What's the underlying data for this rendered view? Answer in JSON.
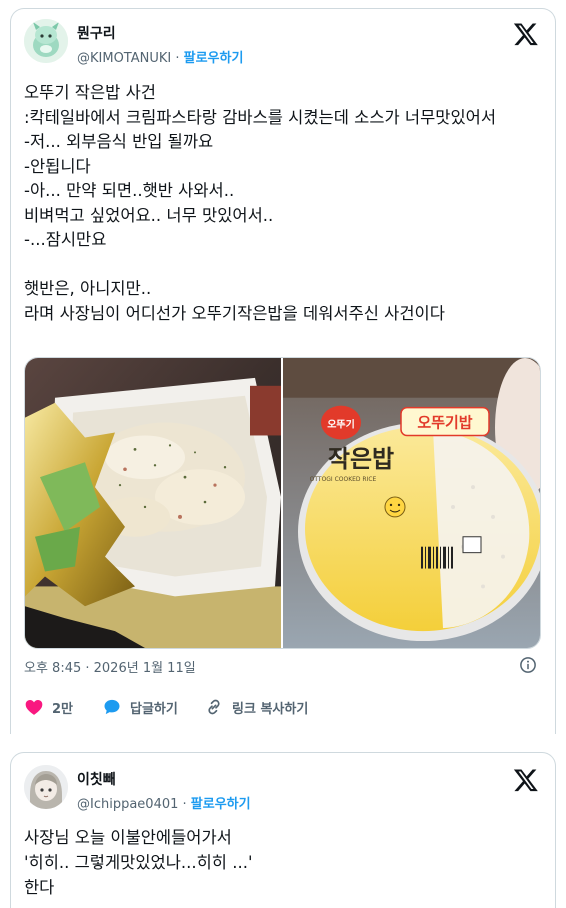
{
  "tweet1": {
    "display_name": "뭔구리",
    "handle": "@KIMOTANUKI",
    "separator": " · ",
    "follow_label": "팔로우하기",
    "text": "오뚜기 작은밥 사건\n:칵테일바에서 크림파스타랑 감바스를 시켰는데 소스가 너무맛있어서\n-저... 외부음식 반입 될까요\n-안됩니다\n-아... 만약 되면..햇반 사와서..\n비벼먹고 싶었어요.. 너무 맛있어서..\n-...잠시만요\n\n햇반은, 아니지만..\n라며 사장님이 어디선가 오뚜기작은밥을 데워서주신 사건이다",
    "timestamp": "오후 8:45 · 2026년 1월 11일",
    "likes": "2만",
    "reply_label": "답글하기",
    "copy_link_label": "링크 복사하기",
    "media": {
      "right_image_text": {
        "brand_badge": "오뚜기",
        "product_name": "작은밥",
        "product_label": "오뚜기밥",
        "english_label": "OTTOGI COOKED RICE"
      }
    }
  },
  "tweet2": {
    "display_name": "이칫빼",
    "handle": "@Ichippae0401",
    "separator": " · ",
    "follow_label": "팔로우하기",
    "text": "사장님 오늘 이불안에들어가서\n'히히.. 그렇게맛있었나...히히 ...'\n한다"
  },
  "colors": {
    "accent": "#1d9bf0",
    "like": "#f91880",
    "text_primary": "#0f1419",
    "text_secondary": "#536471",
    "border": "#cfd9de"
  },
  "icons": [
    "x-logo-icon",
    "heart-icon",
    "reply-bubble-icon",
    "link-icon",
    "info-icon"
  ]
}
